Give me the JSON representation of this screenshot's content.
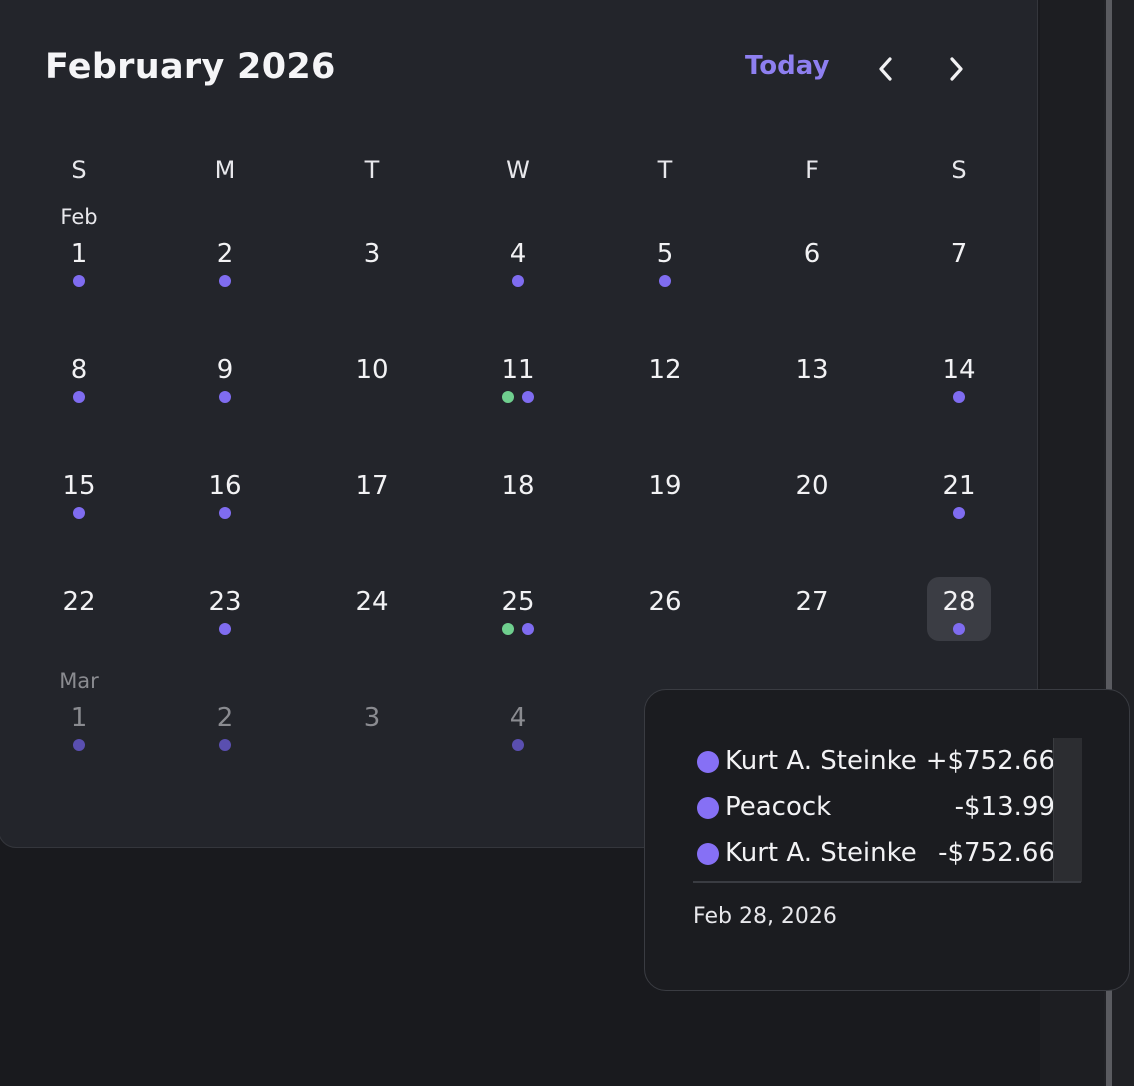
{
  "calendar": {
    "month_title": "February 2026",
    "today_label": "Today",
    "weekdays": [
      "S",
      "M",
      "T",
      "W",
      "T",
      "F",
      "S"
    ],
    "days": [
      {
        "num": "1",
        "month": "Feb",
        "dots": [
          "purple"
        ]
      },
      {
        "num": "2",
        "dots": [
          "purple"
        ]
      },
      {
        "num": "3",
        "dots": []
      },
      {
        "num": "4",
        "dots": [
          "purple"
        ]
      },
      {
        "num": "5",
        "dots": [
          "purple"
        ]
      },
      {
        "num": "6",
        "dots": []
      },
      {
        "num": "7",
        "dots": []
      },
      {
        "num": "8",
        "dots": [
          "purple"
        ]
      },
      {
        "num": "9",
        "dots": [
          "purple"
        ]
      },
      {
        "num": "10",
        "dots": []
      },
      {
        "num": "11",
        "dots": [
          "green",
          "purple"
        ]
      },
      {
        "num": "12",
        "dots": []
      },
      {
        "num": "13",
        "dots": []
      },
      {
        "num": "14",
        "dots": [
          "purple"
        ]
      },
      {
        "num": "15",
        "dots": [
          "purple"
        ]
      },
      {
        "num": "16",
        "dots": [
          "purple"
        ]
      },
      {
        "num": "17",
        "dots": []
      },
      {
        "num": "18",
        "dots": []
      },
      {
        "num": "19",
        "dots": []
      },
      {
        "num": "20",
        "dots": []
      },
      {
        "num": "21",
        "dots": [
          "purple"
        ]
      },
      {
        "num": "22",
        "dots": []
      },
      {
        "num": "23",
        "dots": [
          "purple"
        ]
      },
      {
        "num": "24",
        "dots": []
      },
      {
        "num": "25",
        "dots": [
          "green",
          "purple"
        ]
      },
      {
        "num": "26",
        "dots": []
      },
      {
        "num": "27",
        "dots": []
      },
      {
        "num": "28",
        "dots": [
          "purple"
        ],
        "selected": true
      },
      {
        "num": "1",
        "month": "Mar",
        "dots": [
          "purple"
        ],
        "other": true
      },
      {
        "num": "2",
        "dots": [
          "purple"
        ],
        "other": true
      },
      {
        "num": "3",
        "dots": [],
        "other": true
      },
      {
        "num": "4",
        "dots": [
          "purple"
        ],
        "other": true
      }
    ]
  },
  "tooltip": {
    "transactions": [
      {
        "name": "Kurt A. Steinke",
        "amount": "+$752.66"
      },
      {
        "name": "Peacock",
        "amount": "-$13.99"
      },
      {
        "name": "Kurt A. Steinke",
        "amount": "-$752.66"
      }
    ],
    "date": "Feb 28, 2026"
  },
  "colors": {
    "accent": "#8e7ff0",
    "dot_purple": "#7f6cf0",
    "dot_green": "#6fcf8e",
    "card_bg": "#23252b",
    "page_bg": "#191a1e"
  }
}
